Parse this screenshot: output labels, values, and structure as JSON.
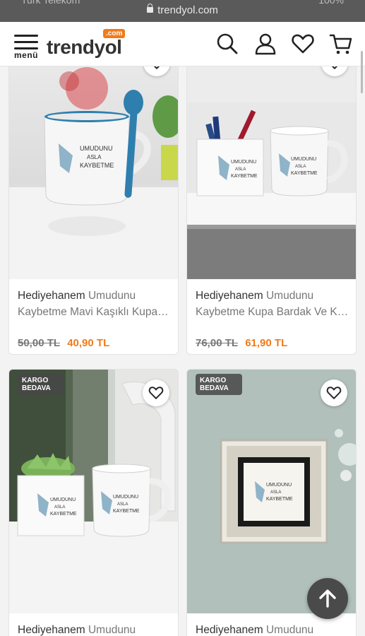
{
  "browser": {
    "url": "trendyol.com",
    "carrier": "Turk Telekom",
    "battery": "100%"
  },
  "header": {
    "menu_label": "menü",
    "logo_word": "trendyol",
    "logo_suffix": ".com",
    "icons": [
      "search-icon",
      "user-icon",
      "heart-icon",
      "cart-icon"
    ]
  },
  "products": [
    {
      "brand": "Hediyehanem",
      "title_line1": "Umudunu",
      "title_line2": "Kaybetme Mavi Kaşıklı Kupa Bardak",
      "old_price": "50,00 TL",
      "new_price": "40,90 TL",
      "badge": ""
    },
    {
      "brand": "Hediyehanem",
      "title_line1": "Umudunu",
      "title_line2": "Kaybetme Kupa Bardak Ve Kalemlik",
      "old_price": "76,00 TL",
      "new_price": "61,90 TL",
      "badge": ""
    },
    {
      "brand": "Hediyehanem",
      "title_line1": "Umudunu",
      "title_line2": "",
      "old_price": "",
      "new_price": "",
      "badge": "KARGO BEDAVA"
    },
    {
      "brand": "Hediyehanem",
      "title_line1": "Umudunu",
      "title_line2": "",
      "old_price": "",
      "new_price": "",
      "badge": "KARGO BEDAVA"
    }
  ],
  "colors": {
    "accent": "#f27a1a",
    "mug_blue": "#2f7fae",
    "text": "#333333"
  }
}
